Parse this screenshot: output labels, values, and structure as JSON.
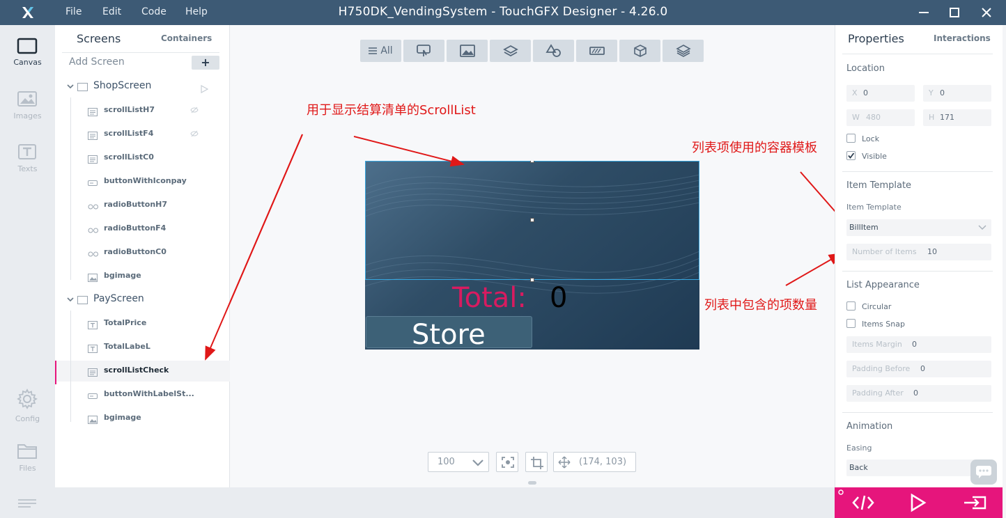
{
  "titlebar": {
    "title": "H750DK_VendingSystem - TouchGFX Designer - 4.26.0",
    "menu": [
      "File",
      "Edit",
      "Code",
      "Help"
    ],
    "logo": "touchgfx-logo"
  },
  "rail": [
    {
      "label": "Canvas",
      "icon": "canvas-icon",
      "active": true
    },
    {
      "label": "Images",
      "icon": "images-icon",
      "active": false
    },
    {
      "label": "Texts",
      "icon": "texts-icon",
      "active": false
    },
    {
      "label": "Config",
      "icon": "gear-icon",
      "active": false
    },
    {
      "label": "Files",
      "icon": "folder-icon",
      "active": false
    }
  ],
  "screens_panel": {
    "tab_screens": "Screens",
    "tab_containers": "Containers",
    "add_screen": "Add Screen",
    "add_button": "+",
    "screens": [
      {
        "name": "ShopScreen",
        "items": [
          {
            "name": "scrollListH7",
            "icon": "scroll-list-icon",
            "hidden": true
          },
          {
            "name": "scrollListF4",
            "icon": "scroll-list-icon",
            "hidden": true
          },
          {
            "name": "scrollListC0",
            "icon": "scroll-list-icon",
            "hidden": false
          },
          {
            "name": "buttonWithIconpay",
            "icon": "button-icon",
            "hidden": false
          },
          {
            "name": "radioButtonH7",
            "icon": "radio-icon",
            "hidden": false
          },
          {
            "name": "radioButtonF4",
            "icon": "radio-icon",
            "hidden": false
          },
          {
            "name": "radioButtonC0",
            "icon": "radio-icon",
            "hidden": false
          },
          {
            "name": "bgimage",
            "icon": "image-icon",
            "hidden": false
          }
        ]
      },
      {
        "name": "PayScreen",
        "items": [
          {
            "name": "TotalPrice",
            "icon": "text-icon",
            "hidden": false
          },
          {
            "name": "TotalLabeL",
            "icon": "text-icon",
            "hidden": false
          },
          {
            "name": "scrollListCheck",
            "icon": "scroll-list-icon",
            "hidden": false,
            "selected": true
          },
          {
            "name": "buttonWithLabelSt...",
            "icon": "button-icon",
            "hidden": false
          },
          {
            "name": "bgimage",
            "icon": "image-icon",
            "hidden": false
          }
        ]
      }
    ]
  },
  "toolbar": {
    "all_label": "All",
    "tools": [
      "interaction-icon",
      "image-icon",
      "container-icon",
      "shapes-icon",
      "progress-icon",
      "3d-icon",
      "layers-icon"
    ]
  },
  "preview": {
    "total_label": "Total:",
    "total_value": "0",
    "store_label": "Store"
  },
  "zoom": {
    "value": "100",
    "coords": "(174, 103)"
  },
  "annotations": {
    "scrolllist": "用于显示结算清单的ScrollList",
    "template": "列表项使用的容器模板",
    "count": "列表中包含的项数量"
  },
  "properties": {
    "tab_properties": "Properties",
    "tab_interactions": "Interactions",
    "location": "Location",
    "x_label": "X",
    "x": "0",
    "y_label": "Y",
    "y": "0",
    "w_label": "W",
    "w": "480",
    "h_label": "H",
    "h": "171",
    "lock": "Lock",
    "visible": "Visible",
    "visible_checked": true,
    "item_template_section": "Item Template",
    "item_template_label": "Item Template",
    "item_template_value": "BillItem",
    "num_items_label": "Number of Items",
    "num_items": "10",
    "list_appearance": "List Appearance",
    "circular": "Circular",
    "items_snap": "Items Snap",
    "items_margin_label": "Items Margin",
    "items_margin": "0",
    "padding_before_label": "Padding Before",
    "padding_before": "0",
    "padding_after_label": "Padding After",
    "padding_after": "0",
    "animation": "Animation",
    "easing_label": "Easing",
    "easing_value": "Back"
  },
  "colors": {
    "accent": "#e6157c",
    "titlebar": "#3d5a75",
    "annotation": "#e01818"
  }
}
